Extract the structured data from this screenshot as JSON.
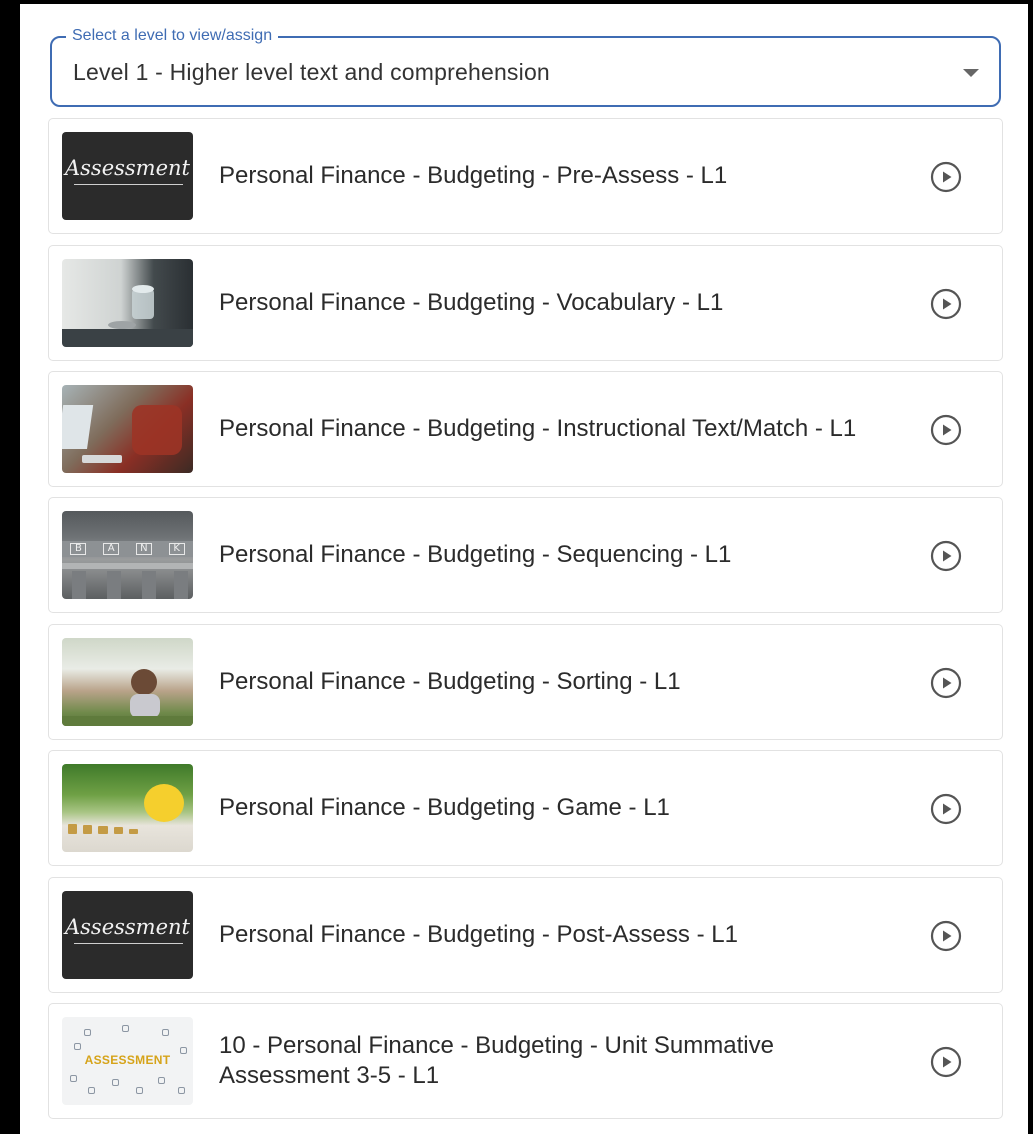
{
  "level_select": {
    "legend": "Select a level to view/assign",
    "value": "Level 1 - Higher level text and comprehension"
  },
  "icons": {
    "dropdown": "caret-down-icon",
    "play": "play-circle-icon"
  },
  "thumbnail_text": {
    "assessment_chalk": "Assessment",
    "bank_letters": [
      "B",
      "A",
      "N",
      "K"
    ],
    "assessment_badge": "ASSESSMENT"
  },
  "items": [
    {
      "title": "Personal Finance - Budgeting - Pre-Assess - L1",
      "thumbnail": "assessment-chalkboard"
    },
    {
      "title": "Personal Finance - Budgeting - Vocabulary - L1",
      "thumbnail": "coins-jar-photo"
    },
    {
      "title": "Personal Finance - Budgeting - Instructional Text/Match - L1",
      "thumbnail": "man-with-laptop-photo"
    },
    {
      "title": "Personal Finance - Budgeting - Sequencing - L1",
      "thumbnail": "bank-building-photo"
    },
    {
      "title": "Personal Finance - Budgeting - Sorting - L1",
      "thumbnail": "thinking-girl-photo"
    },
    {
      "title": "Personal Finance - Budgeting - Game - L1",
      "thumbnail": "piggy-bank-photo"
    },
    {
      "title": "Personal Finance - Budgeting - Post-Assess - L1",
      "thumbnail": "assessment-chalkboard"
    },
    {
      "title": "10 - Personal Finance - Budgeting - Unit Summative Assessment 3-5 - L1",
      "thumbnail": "assessment-icons-graphic"
    }
  ],
  "colors": {
    "accent": "#3f6cb3",
    "frame": "#000000",
    "card_border": "#e2e2e2",
    "icon": "#555555"
  }
}
